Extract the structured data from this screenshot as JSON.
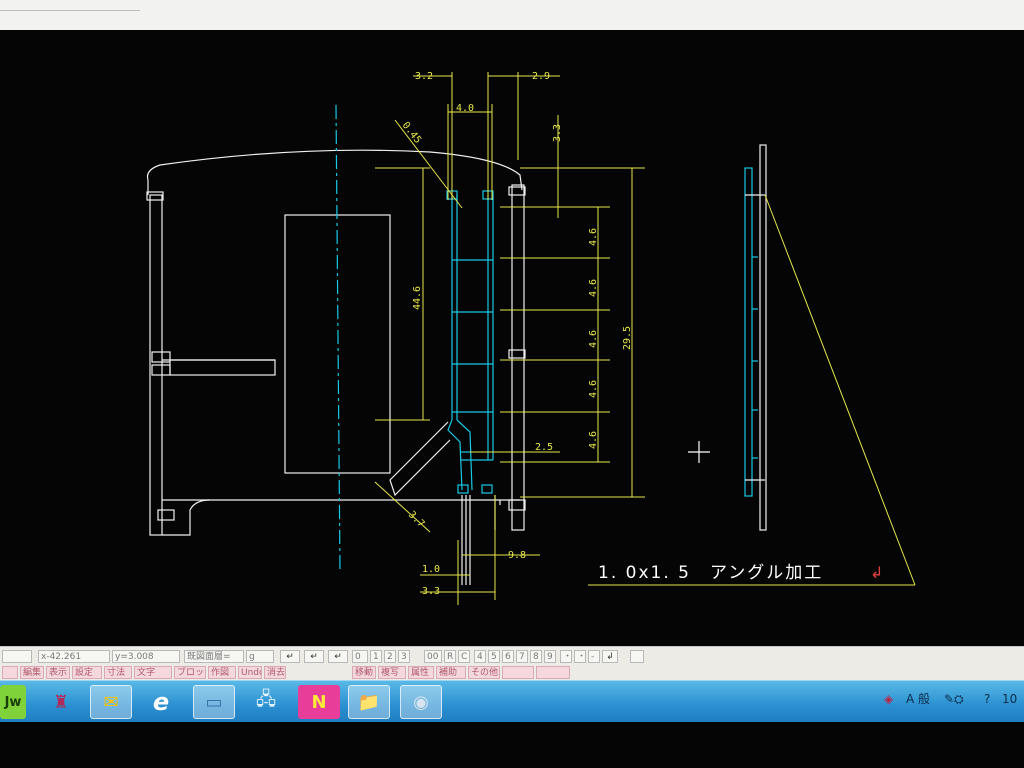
{
  "colors": {
    "canvas_bg": "#050505",
    "white_line": "#f0f0f0",
    "cyan_line": "#19c8e6",
    "dim_yellow": "#e8e84a",
    "annotation_white": "#ffffff",
    "enter_mark": "#e04040"
  },
  "drawing": {
    "dimensions": {
      "top_3_2": "3.2",
      "top_4_0": "4.0",
      "top_2_9": "2.9",
      "right_3_3": "3.3",
      "diag_0_45": "0.45",
      "left_44_6": "44.6",
      "step_1": "4.6",
      "step_2": "4.6",
      "step_3": "4.6",
      "step_4": "4.6",
      "step_5": "4.6",
      "step_6": "4.6",
      "overall_29_5": "29.5",
      "mid_2_5": "2.5",
      "diag_3_7": "3.7",
      "bottom_1_0": "1.0",
      "bottom_9_8": "9.8",
      "bottom_3_3": "3.3"
    },
    "note": "1. 0x1. 5　アングル加工",
    "enter_symbol": "↲"
  },
  "status_bar": {
    "coord_x": "x-42.261",
    "coord_y": "y=3.008",
    "layer_field": "既図面層=",
    "layer_suffix": "g",
    "undo_label": "Undo",
    "number_buttons": [
      "0",
      "1",
      "2",
      "3",
      "00",
      "R",
      "C",
      "4",
      "5",
      "6",
      "7",
      "8",
      "9",
      "・",
      "・",
      "-",
      "↲"
    ],
    "row2_buttons": [
      "編集",
      "表示",
      "設定",
      "寸法",
      "文字",
      "ブロック",
      "作図",
      "消去",
      "移動",
      "複写",
      "属性",
      "補助",
      "その他"
    ]
  },
  "taskbar": {
    "apps": [
      {
        "name": "jw-cad",
        "glyph": "Jw"
      },
      {
        "name": "game-app",
        "glyph": "♜"
      },
      {
        "name": "mail",
        "glyph": "✉"
      },
      {
        "name": "internet-explorer",
        "glyph": "e"
      },
      {
        "name": "explorer-window",
        "glyph": "▭"
      },
      {
        "name": "network-app",
        "glyph": "🖧"
      },
      {
        "name": "ne-app",
        "glyph": "N"
      },
      {
        "name": "folder",
        "glyph": "📁"
      },
      {
        "name": "disk-app",
        "glyph": "◉"
      }
    ],
    "tray": {
      "ime_label": "A 般",
      "clock": "10"
    }
  }
}
